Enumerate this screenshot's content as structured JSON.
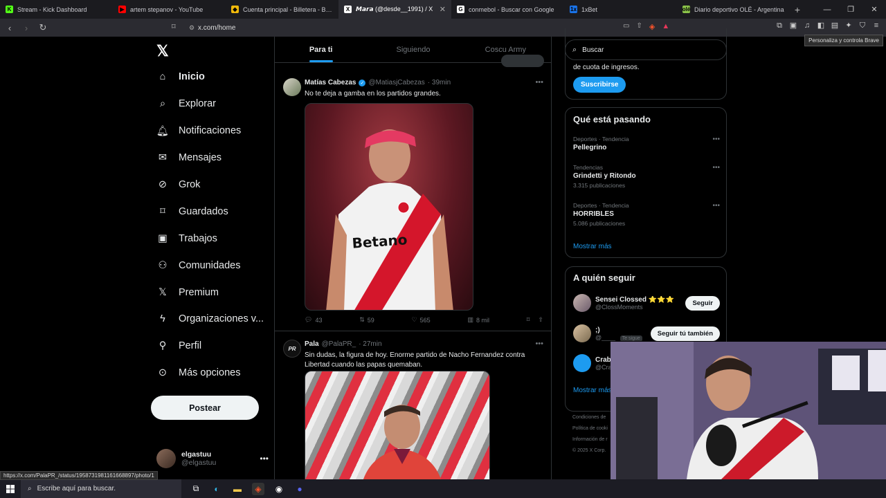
{
  "browser": {
    "tabs": [
      {
        "title": "Stream - Kick Dashboard",
        "favicon": "K",
        "color": "#53fc18"
      },
      {
        "title": "artem stepanov - YouTube",
        "favicon": "▶",
        "color": "#ff0000"
      },
      {
        "title": "Cuenta principal - Billetera - Binance",
        "favicon": "◆",
        "color": "#f0b90b"
      },
      {
        "title": "𝙈𝙖𝙧𝙖 (@desde__1991) / X",
        "favicon": "X",
        "color": "#ffffff"
      },
      {
        "title": "conmebol - Buscar con Google",
        "favicon": "G",
        "color": "#ffffff"
      },
      {
        "title": "1xBet",
        "favicon": "1x",
        "color": "#1a73e8"
      },
      {
        "title": "Diario deportivo OLÉ - Argentina",
        "favicon": "olé",
        "color": "#8bc34a"
      }
    ],
    "active_tab_index": 3,
    "url": "x.com/home",
    "tooltip": "Personaliza y controla Brave"
  },
  "nav": {
    "items": [
      {
        "label": "Inicio",
        "icon": "home-icon"
      },
      {
        "label": "Explorar",
        "icon": "search-icon"
      },
      {
        "label": "Notificaciones",
        "icon": "bell-icon"
      },
      {
        "label": "Mensajes",
        "icon": "mail-icon"
      },
      {
        "label": "Grok",
        "icon": "grok-icon"
      },
      {
        "label": "Guardados",
        "icon": "bookmark-icon"
      },
      {
        "label": "Trabajos",
        "icon": "briefcase-icon"
      },
      {
        "label": "Comunidades",
        "icon": "communities-icon"
      },
      {
        "label": "Premium",
        "icon": "x-icon"
      },
      {
        "label": "Organizaciones v...",
        "icon": "lightning-icon"
      },
      {
        "label": "Perfil",
        "icon": "person-icon"
      },
      {
        "label": "Más opciones",
        "icon": "more-circle-icon"
      }
    ],
    "post_label": "Postear",
    "profile": {
      "name": "elgastuu",
      "handle": "@elgastuu"
    }
  },
  "feed": {
    "tabs": [
      "Para ti",
      "Siguiendo",
      "Coscu Army"
    ],
    "tweets": [
      {
        "name": "Matías Cabezas",
        "handle": "@MatiasjCabezas",
        "time": "· 39min",
        "text": "No te deja a gamba en los partidos grandes.",
        "replies": "43",
        "retweets": "59",
        "likes": "565",
        "views": "8 mil",
        "media_text": [
          "Betano"
        ]
      },
      {
        "name": "Pala",
        "handle": "@PalaPR_",
        "time": "· 27min",
        "avatar_text": "PR",
        "text": "Sin dudas, la figura de hoy. Enorme partido de Nacho Fernandez contra Libertad cuando las papas quemaban."
      }
    ]
  },
  "sidebar": {
    "search_placeholder": "Buscar",
    "premium_text": "de cuota de ingresos.",
    "subscribe_label": "Suscribirse",
    "trends_title": "Qué está pasando",
    "trends": [
      {
        "meta": "Deportes · Tendencia",
        "name": "Pellegrino",
        "count": ""
      },
      {
        "meta": "Tendencias",
        "name": "Grindetti y Ritondo",
        "count": "3.315 publicaciones"
      },
      {
        "meta": "Deportes · Tendencia",
        "name": "HORRIBLES",
        "count": "5.086 publicaciones"
      }
    ],
    "show_more": "Mostrar más",
    "follow_title": "A quién seguir",
    "follow": [
      {
        "name": "Sensei Clossed ⭐⭐⭐",
        "handle": "@ClossMoments",
        "button": "Seguir",
        "badge": ""
      },
      {
        "name": ";)",
        "handle": "@____",
        "button": "Seguir tú también",
        "badge": "Te sigue"
      },
      {
        "name": "Crab",
        "handle": "@Cra",
        "button": "",
        "badge": ""
      }
    ],
    "follow_more": "Mostrar más",
    "footer": [
      "Condiciones de",
      "Política de cooki",
      "Información de r",
      "© 2025 X Corp."
    ]
  },
  "status_url": "https://x.com/PalaPR_/status/1958731981161668897/photo/1",
  "taskbar": {
    "search_placeholder": "Escribe aquí para buscar."
  }
}
